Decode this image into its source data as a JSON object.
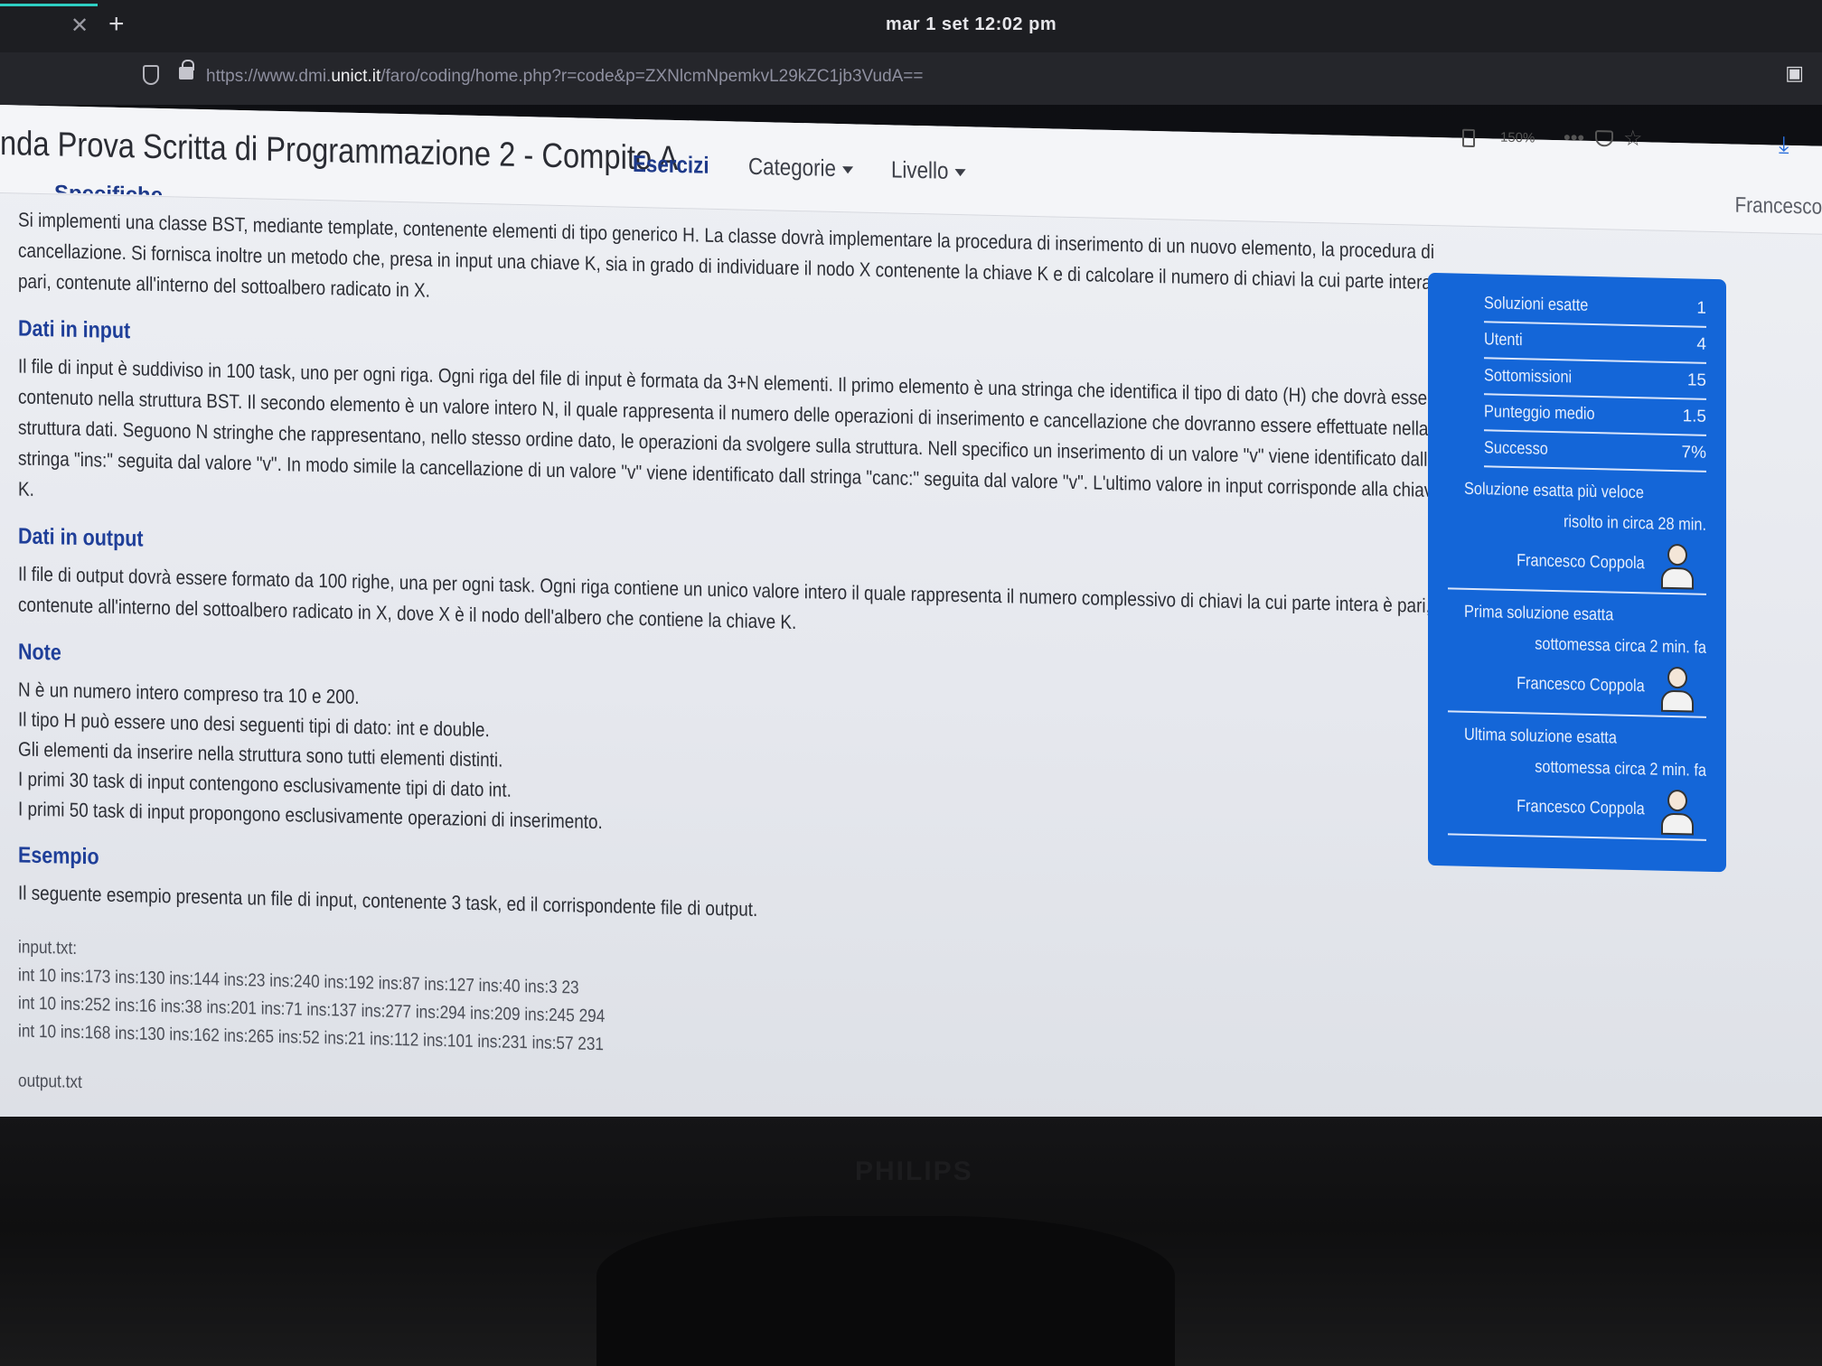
{
  "system": {
    "clock": "mar 1 set  12:02 pm"
  },
  "browser": {
    "url_prefix": "https://www.dmi.",
    "url_domain": "unict.it",
    "url_path": "/faro/coding/home.php?r=code&p=ZXNlcmNpemkvL29kZC1jb3VudA==",
    "zoom": "150%"
  },
  "navbar": {
    "title": "nda Prova Scritta di Programmazione 2 - Compito A",
    "items": [
      {
        "label": "Esercizi",
        "active": true
      },
      {
        "label": "Categorie",
        "dropdown": true
      },
      {
        "label": "Livello",
        "dropdown": true
      }
    ],
    "user": "Francesco"
  },
  "content": {
    "cut_heading": "Specifiche",
    "intro": "Si implementi una classe BST, mediante template, contenente elementi di tipo generico H. La classe dovrà implementare la procedura di inserimento di un nuovo elemento, la procedura di cancellazione. Si fornisca inoltre un metodo che, presa in input una chiave K, sia in grado di individuare il nodo X contenente la chiave K e di calcolare il numero di chiavi la cui parte intera è pari, contenute all'interno del sottoalbero radicato in X.",
    "input_heading": "Dati in input",
    "input_text": "Il file di input è suddiviso in 100 task, uno per ogni riga. Ogni riga del file di input è formata da 3+N elementi. Il primo elemento è una stringa che identifica il tipo di dato (H) che dovrà essere contenuto nella struttura BST. Il secondo elemento è un valore intero N, il quale rappresenta il numero delle operazioni di inserimento e cancellazione che dovranno essere effettuate nella struttura dati. Seguono N stringhe che rappresentano, nello stesso ordine dato, le operazioni da svolgere sulla struttura. Nell specifico un inserimento di un valore \"v\" viene identificato dall stringa \"ins:\" seguita dal valore \"v\". In modo simile la cancellazione di un valore \"v\" viene identificato dall stringa \"canc:\" seguita dal valore \"v\". L'ultimo valore in input corrisponde alla chiave K.",
    "output_heading": "Dati in output",
    "output_text": "Il file di output dovrà essere formato da 100 righe, una per ogni task. Ogni riga contiene un unico valore intero il quale rappresenta il numero complessivo di chiavi la cui parte intera è pari, contenute all'interno del sottoalbero radicato in X, dove X è il nodo dell'albero che contiene la chiave K.",
    "note_heading": "Note",
    "notes": [
      "N è un numero intero compreso tra 10 e 200.",
      "Il tipo H può essere uno desi seguenti tipi di dato: int e double.",
      "Gli elementi da inserire nella struttura sono tutti elementi distinti.",
      "I primi 30 task di input contengono esclusivamente tipi di dato int.",
      "I primi 50 task di input propongono esclusivamente operazioni di inserimento."
    ],
    "example_heading": "Esempio",
    "example_text": "Il seguente esempio presenta un file di input, contenente 3 task, ed il corrispondente file di output.",
    "input_label": "input.txt:",
    "input_lines": [
      "int 10 ins:173 ins:130 ins:144 ins:23 ins:240 ins:192 ins:87 ins:127 ins:40 ins:3 23",
      "int 10 ins:252 ins:16 ins:38 ins:201 ins:71 ins:137 ins:277 ins:294 ins:209 ins:245 294",
      "int 10 ins:168 ins:130 ins:162 ins:265 ins:52 ins:21 ins:112 ins:101 ins:231 ins:57 231"
    ],
    "output_label": "output.txt"
  },
  "sidebar": {
    "stats": [
      {
        "label": "Soluzioni esatte",
        "value": "1"
      },
      {
        "label": "Utenti",
        "value": "4"
      },
      {
        "label": "Sottomissioni",
        "value": "15"
      },
      {
        "label": "Punteggio medio",
        "value": "1.5"
      },
      {
        "label": "Successo",
        "value": "7%"
      }
    ],
    "fastest_label": "Soluzione esatta più veloce",
    "fastest_sub": "risolto in circa 28 min.",
    "fastest_user": "Francesco Coppola",
    "first_label": "Prima soluzione esatta",
    "first_sub": "sottomessa circa 2 min. fa",
    "first_user": "Francesco Coppola",
    "last_label": "Ultima soluzione esatta",
    "last_sub": "sottomessa circa 2 min. fa",
    "last_user": "Francesco Coppola"
  },
  "monitor": {
    "brand": "PHILIPS"
  }
}
